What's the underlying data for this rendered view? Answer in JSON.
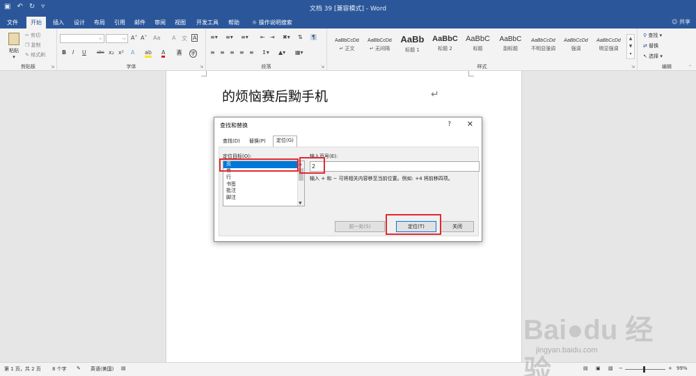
{
  "app": {
    "window_title": "文档 39 [兼容模式] - Word",
    "share": "共享"
  },
  "menu": {
    "tabs": [
      "文件",
      "开始",
      "插入",
      "设计",
      "布局",
      "引用",
      "邮件",
      "审阅",
      "视图",
      "开发工具",
      "帮助"
    ],
    "active": "开始",
    "tell_me": "操作说明搜索"
  },
  "ribbon": {
    "clipboard": {
      "label": "剪贴板",
      "paste": "粘贴",
      "cut": "剪切",
      "copy": "复制",
      "format_painter": "格式刷"
    },
    "font": {
      "label": "字体",
      "grow": "A˄",
      "shrink": "A˅",
      "case": "Aa",
      "clear": "A",
      "wen": "文",
      "bold": "B",
      "italic": "I",
      "underline": "U",
      "strike": "abc",
      "sub": "x₂",
      "sup": "x²",
      "text_effect": "A",
      "highlight": "ab",
      "font_color": "A",
      "shade": "A",
      "border": "A"
    },
    "paragraph": {
      "label": "段落"
    },
    "styles": {
      "label": "样式",
      "items": [
        {
          "preview": "AaBbCcDd",
          "name": "↵ 正文"
        },
        {
          "preview": "AaBbCcDd",
          "name": "↵ 无间隔"
        },
        {
          "preview": "AaBb",
          "name": "标题 1"
        },
        {
          "preview": "AaBbC",
          "name": "标题 2"
        },
        {
          "preview": "AaBbC",
          "name": "标题"
        },
        {
          "preview": "AaBbC",
          "name": "副标题"
        },
        {
          "preview": "AaBbCcDd",
          "name": "不明显强调"
        },
        {
          "preview": "AaBbCcDd",
          "name": "强调"
        },
        {
          "preview": "AaBbCcDd",
          "name": "明显强调"
        }
      ]
    },
    "editing": {
      "label": "编辑",
      "find": "查找",
      "replace": "替换",
      "select": "选择"
    }
  },
  "document": {
    "text": "的烦恼赛后黝手机",
    "para_mark": "↵"
  },
  "dialog": {
    "title": "查找和替换",
    "help": "?",
    "close": "✕",
    "tabs": [
      "查找(D)",
      "替换(P)",
      "定位(G)"
    ],
    "active_tab": "定位(G)",
    "target_label": "定位目标(O):",
    "targets": [
      "页",
      "节",
      "行",
      "书签",
      "批注",
      "脚注"
    ],
    "selected_target": "页",
    "page_label": "输入页号(E):",
    "page_value": "2",
    "hint": "输入 + 和 − 可将相关内容移至当前位置。例如: +4 将前移四项。",
    "buttons": {
      "previous": "前一处(S)",
      "goto": "定位(T)",
      "close": "关闭"
    }
  },
  "status": {
    "page": "第 1 页，共 2 页",
    "words": "8 个字",
    "language": "英语(美国)",
    "zoom": "99%"
  },
  "watermark": {
    "logo": "Bai●du 经验",
    "url": "jingyan.baidu.com"
  }
}
